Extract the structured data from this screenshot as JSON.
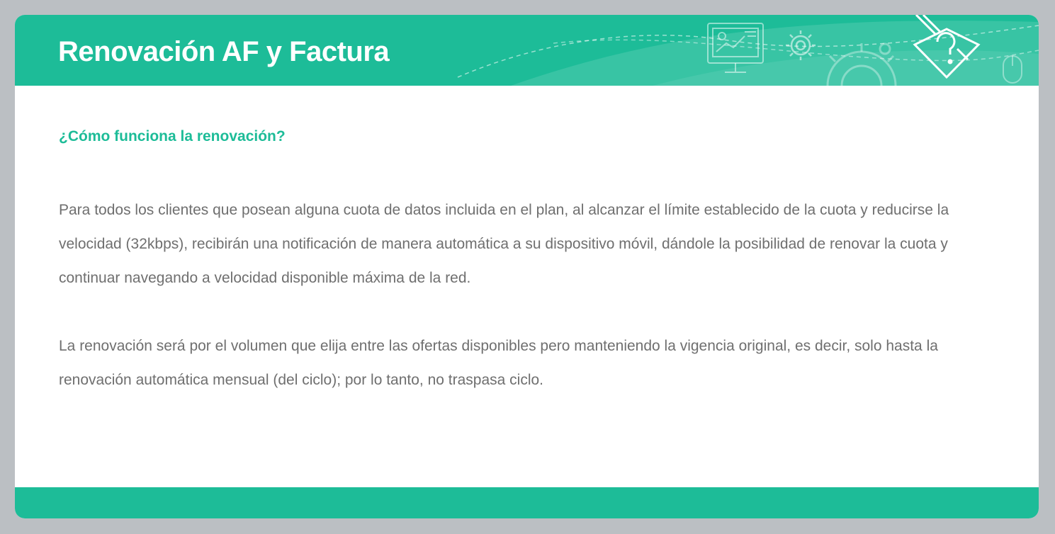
{
  "header": {
    "title": "Renovación AF y Factura",
    "background_color": "#1dbc98",
    "decor_icons": [
      "presentation-monitor-icon",
      "gear-icon",
      "large-gear-icon",
      "mouse-icon",
      "help-edit-icon"
    ]
  },
  "content": {
    "question": "¿Cómo funciona la renovación?",
    "paragraphs": [
      "Para todos los clientes que posean alguna cuota de datos incluida en el plan, al alcanzar el límite establecido de la cuota y reducirse la velocidad (32kbps), recibirán una notificación de manera automática a su dispositivo móvil, dándole la posibilidad de renovar la cuota y continuar navegando a velocidad disponible máxima de la red.",
      "La renovación será por el volumen que elija entre las ofertas disponibles pero manteniendo la vigencia original, es decir, solo hasta la renovación automática mensual (del ciclo); por lo tanto, no traspasa ciclo."
    ],
    "question_color": "#1dbc98",
    "text_color": "#6f6f6f"
  },
  "footer": {
    "background_color": "#1dbc98"
  }
}
